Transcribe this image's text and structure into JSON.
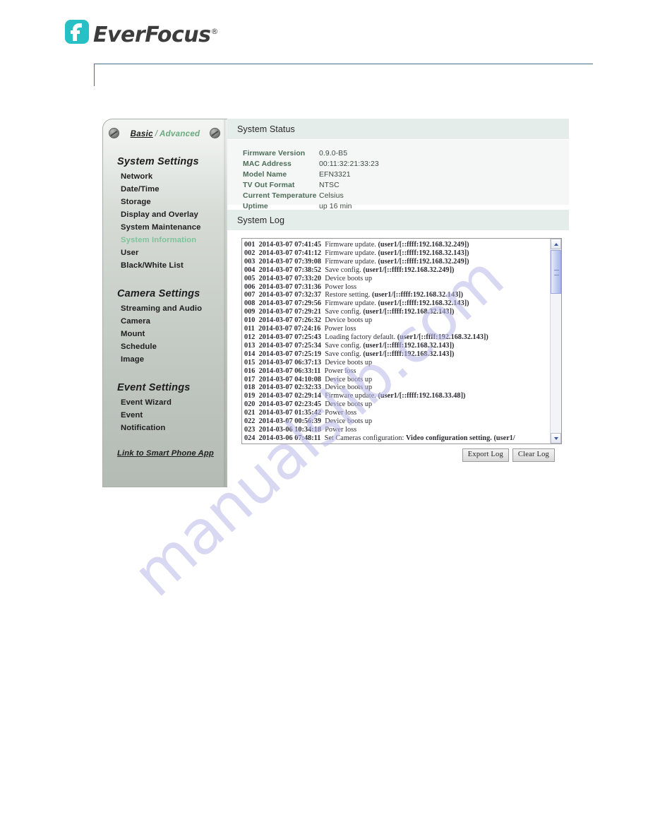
{
  "brand": {
    "name": "EverFocus",
    "registered": "®"
  },
  "sidebar": {
    "tabs": {
      "basic": "Basic",
      "separator": "/",
      "advanced": "Advanced"
    },
    "groups": [
      {
        "title": "System Settings",
        "items": [
          "Network",
          "Date/Time",
          "Storage",
          "Display and Overlay",
          "System Maintenance",
          "System Information",
          "User",
          "Black/White List"
        ],
        "active": "System Information"
      },
      {
        "title": "Camera Settings",
        "items": [
          "Streaming and Audio",
          "Camera",
          "Mount",
          "Schedule",
          "Image"
        ],
        "active": ""
      },
      {
        "title": "Event Settings",
        "items": [
          "Event Wizard",
          "Event",
          "Notification"
        ],
        "active": ""
      }
    ],
    "link": "Link to Smart Phone App"
  },
  "system_status": {
    "title": "System Status",
    "rows": [
      {
        "label": "Firmware Version",
        "value": "0.9.0-B5"
      },
      {
        "label": "MAC Address",
        "value": "00:11:32:21:33:23"
      },
      {
        "label": "Model Name",
        "value": "EFN3321"
      },
      {
        "label": "TV Out Format",
        "value": "NTSC"
      },
      {
        "label": "Current Temperature",
        "value": "Celsius"
      },
      {
        "label": "Uptime",
        "value": "up 16 min"
      }
    ]
  },
  "system_log": {
    "title": "System Log",
    "entries": [
      {
        "idx": "001",
        "ts": "2014-03-07 07:41:45",
        "msg": "Firmware update.",
        "det": "(user1/[::ffff:192.168.32.249])"
      },
      {
        "idx": "002",
        "ts": "2014-03-07 07:41:12",
        "msg": "Firmware update.",
        "det": "(user1/[::ffff:192.168.32.143])"
      },
      {
        "idx": "003",
        "ts": "2014-03-07 07:39:08",
        "msg": "Firmware update.",
        "det": "(user1/[::ffff:192.168.32.249])"
      },
      {
        "idx": "004",
        "ts": "2014-03-07 07:38:52",
        "msg": "Save config.",
        "det": "(user1/[::ffff:192.168.32.249])"
      },
      {
        "idx": "005",
        "ts": "2014-03-07 07:33:20",
        "msg": "Device boots up",
        "det": ""
      },
      {
        "idx": "006",
        "ts": "2014-03-07 07:31:36",
        "msg": "Power loss",
        "det": ""
      },
      {
        "idx": "007",
        "ts": "2014-03-07 07:32:37",
        "msg": "Restore setting.",
        "det": "(user1/[::ffff:192.168.32.143])"
      },
      {
        "idx": "008",
        "ts": "2014-03-07 07:29:56",
        "msg": "Firmware update.",
        "det": "(user1/[::ffff:192.168.32.143])"
      },
      {
        "idx": "009",
        "ts": "2014-03-07 07:29:21",
        "msg": "Save config.",
        "det": "(user1/[::ffff:192.168.32.143])"
      },
      {
        "idx": "010",
        "ts": "2014-03-07 07:26:32",
        "msg": "Device boots up",
        "det": ""
      },
      {
        "idx": "011",
        "ts": "2014-03-07 07:24:16",
        "msg": "Power loss",
        "det": ""
      },
      {
        "idx": "012",
        "ts": "2014-03-07 07:25:43",
        "msg": "Loading factory default.",
        "det": "(user1/[::ffff:192.168.32.143])"
      },
      {
        "idx": "013",
        "ts": "2014-03-07 07:25:34",
        "msg": "Save config.",
        "det": "(user1/[::ffff:192.168.32.143])"
      },
      {
        "idx": "014",
        "ts": "2014-03-07 07:25:19",
        "msg": "Save config.",
        "det": "(user1/[::ffff:192.168.32.143])"
      },
      {
        "idx": "015",
        "ts": "2014-03-07 06:37:13",
        "msg": "Device boots up",
        "det": ""
      },
      {
        "idx": "016",
        "ts": "2014-03-07 06:33:11",
        "msg": "Power loss",
        "det": ""
      },
      {
        "idx": "017",
        "ts": "2014-03-07 04:10:08",
        "msg": "Device boots up",
        "det": ""
      },
      {
        "idx": "018",
        "ts": "2014-03-07 02:32:33",
        "msg": "Device boots up",
        "det": ""
      },
      {
        "idx": "019",
        "ts": "2014-03-07 02:29:14",
        "msg": "Firmware update.",
        "det": "(user1/[::ffff:192.168.33.48])"
      },
      {
        "idx": "020",
        "ts": "2014-03-07 02:23:45",
        "msg": "Device boots up",
        "det": ""
      },
      {
        "idx": "021",
        "ts": "2014-03-07 01:35:42",
        "msg": "Power loss",
        "det": ""
      },
      {
        "idx": "022",
        "ts": "2014-03-07 00:56:39",
        "msg": "Device boots up",
        "det": ""
      },
      {
        "idx": "023",
        "ts": "2014-03-06 10:34:18",
        "msg": "Power loss",
        "det": ""
      },
      {
        "idx": "024",
        "ts": "2014-03-06 07:48:11",
        "msg": "Set Cameras configuration:",
        "det": "Video configuration setting. (user1/"
      }
    ],
    "export_label": "Export Log",
    "clear_label": "Clear Log"
  },
  "watermark": {
    "text": "manualslib.com"
  },
  "colors": {
    "brand_teal": "#27c0c4",
    "active_green": "#7fc39a",
    "section_header": "#e5edea",
    "status_label": "#4d6b59"
  }
}
